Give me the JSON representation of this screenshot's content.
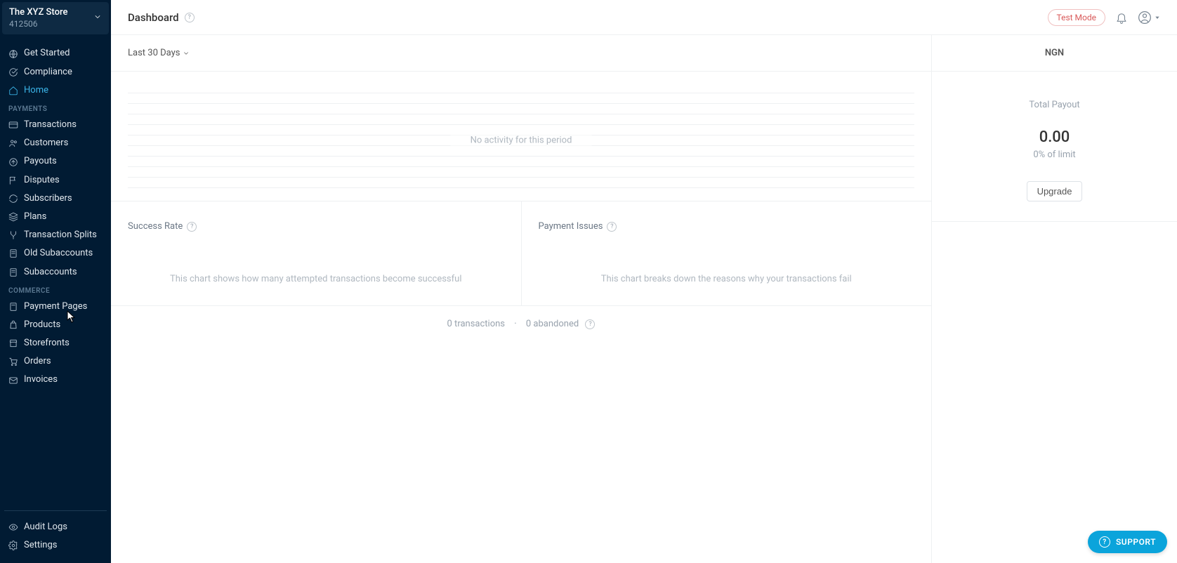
{
  "store": {
    "name": "The XYZ Store",
    "id": "412506"
  },
  "nav": {
    "top": [
      {
        "label": "Get Started",
        "icon": "globe"
      },
      {
        "label": "Compliance",
        "icon": "check-circle"
      },
      {
        "label": "Home",
        "icon": "home",
        "active": true
      }
    ],
    "sections": [
      {
        "title": "PAYMENTS",
        "items": [
          {
            "label": "Transactions",
            "icon": "card"
          },
          {
            "label": "Customers",
            "icon": "users"
          },
          {
            "label": "Payouts",
            "icon": "arrow-up-circle"
          },
          {
            "label": "Disputes",
            "icon": "flag"
          },
          {
            "label": "Subscribers",
            "icon": "refresh"
          },
          {
            "label": "Plans",
            "icon": "layers"
          },
          {
            "label": "Transaction Splits",
            "icon": "split"
          },
          {
            "label": "Old Subaccounts",
            "icon": "page"
          },
          {
            "label": "Subaccounts",
            "icon": "page"
          }
        ]
      },
      {
        "title": "COMMERCE",
        "items": [
          {
            "label": "Payment Pages",
            "icon": "page"
          },
          {
            "label": "Products",
            "icon": "bag"
          },
          {
            "label": "Storefronts",
            "icon": "store"
          },
          {
            "label": "Orders",
            "icon": "cart"
          },
          {
            "label": "Invoices",
            "icon": "mail"
          }
        ]
      }
    ],
    "footer": [
      {
        "label": "Audit Logs",
        "icon": "eye"
      },
      {
        "label": "Settings",
        "icon": "gear"
      }
    ]
  },
  "header": {
    "title": "Dashboard",
    "test_mode": "Test Mode"
  },
  "filters": {
    "date_range": "Last 30 Days"
  },
  "activity": {
    "empty_text": "No activity for this period"
  },
  "charts": {
    "success": {
      "title": "Success Rate",
      "empty": "This chart shows how many attempted transactions become successful"
    },
    "issues": {
      "title": "Payment Issues",
      "empty": "This chart breaks down the reasons why your transactions fail"
    }
  },
  "summary": {
    "transactions": "0 transactions",
    "abandoned": "0 abandoned"
  },
  "side": {
    "currency": "NGN",
    "payout_label": "Total Payout",
    "payout_value": "0.00",
    "payout_sub": "0% of limit",
    "upgrade": "Upgrade"
  },
  "support": {
    "label": "SUPPORT"
  }
}
